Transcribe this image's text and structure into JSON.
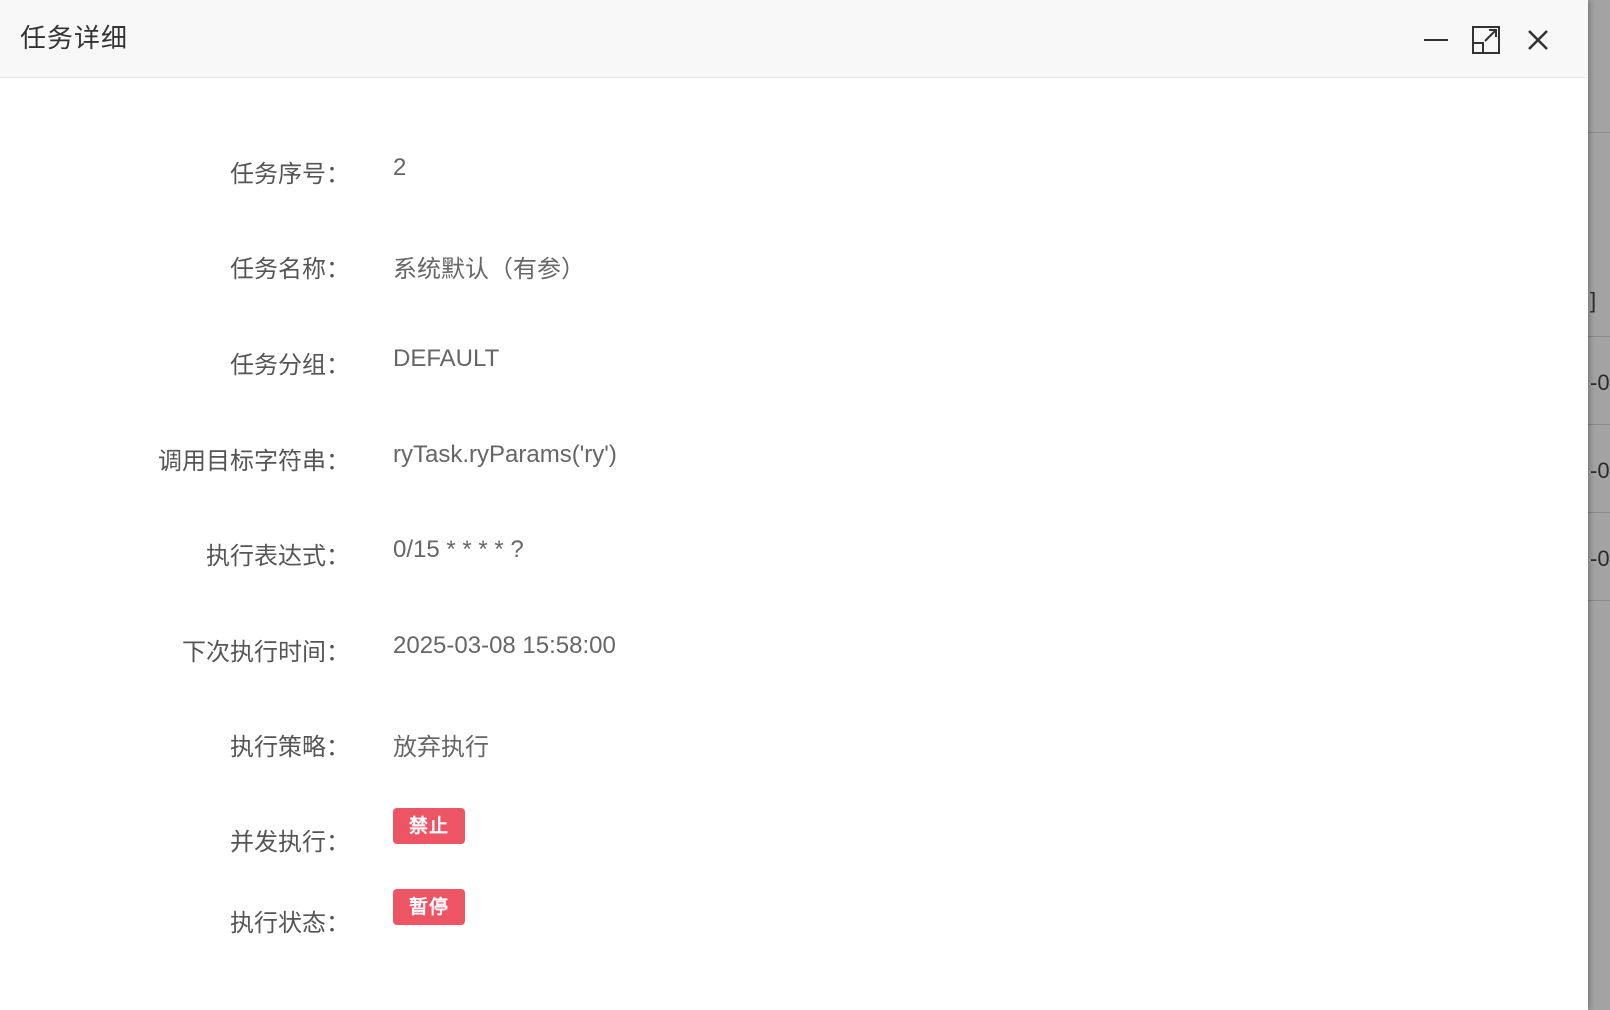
{
  "dialog": {
    "title": "任务详细",
    "controls": {
      "minimize": "minimize-icon",
      "maximize": "maximize-icon",
      "close": "close-icon"
    }
  },
  "fields": [
    {
      "label": "任务序号：",
      "value": "2"
    },
    {
      "label": "任务名称：",
      "value": "系统默认（有参）"
    },
    {
      "label": "任务分组：",
      "value": "DEFAULT"
    },
    {
      "label": "调用目标字符串：",
      "value": "ryTask.ryParams('ry')"
    },
    {
      "label": "执行表达式：",
      "value": "0/15 * * * * ?"
    },
    {
      "label": "下次执行时间：",
      "value": "2025-03-08 15:58:00"
    },
    {
      "label": "执行策略：",
      "value": "放弃执行"
    }
  ],
  "badges": [
    {
      "label": "并发执行：",
      "value": "禁止"
    },
    {
      "label": "执行状态：",
      "value": "暂停"
    }
  ],
  "background": {
    "fragments": [
      "]",
      "-0",
      "-0",
      "-0"
    ]
  },
  "colors": {
    "badge": "#ed5565",
    "titlebar": "#f8f8f8"
  }
}
